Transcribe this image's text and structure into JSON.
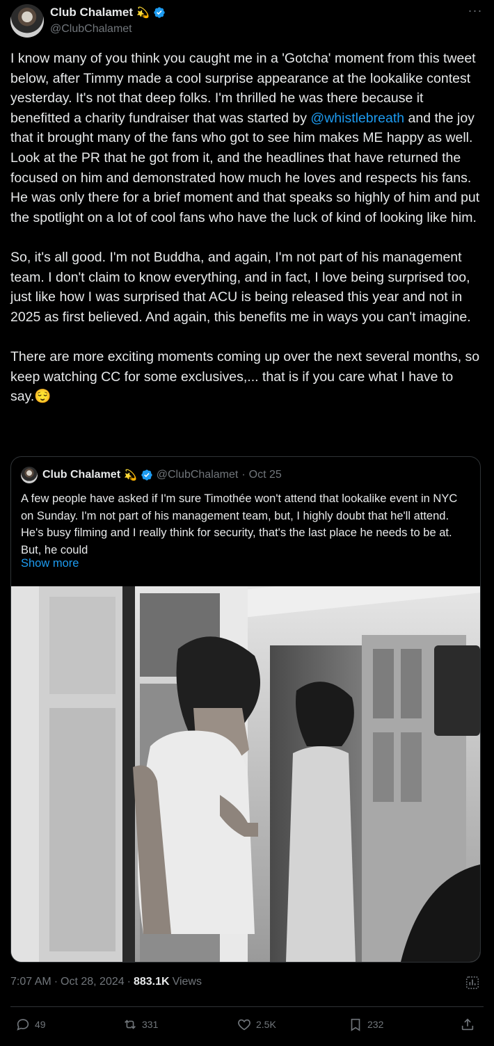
{
  "author": {
    "name": "Club Chalamet",
    "name_emoji": "💫",
    "handle": "@ClubChalamet"
  },
  "tweet": {
    "paragraphs": [
      {
        "before": "I know many of you think you caught me in a 'Gotcha' moment from this tweet below, after Timmy made a cool surprise appearance at the lookalike contest yesterday. It's not that deep folks. I'm thrilled he was there because it benefitted a charity fundraiser that was started by ",
        "mention": "@whistlebreath",
        "after": " and the joy that it brought many of the fans who got to see him makes ME happy as well. Look at the PR that he got from it, and the headlines that have returned the focused on him and demonstrated how much he loves and respects his fans. He was only there for a brief moment and that speaks so highly of him and put the spotlight on a lot of cool fans who have the luck of kind of looking like him."
      },
      {
        "text": "So, it's all good. I'm not Buddha, and again, I'm not part of his management team. I don't claim to know everything, and in fact, I love being surprised too, just like how I was surprised that ACU is being released this year and not in 2025 as first believed. And again, this benefits me in ways you can't imagine."
      },
      {
        "text": "There are more exciting moments coming up over the next several months, so keep watching CC for some exclusives,... that is if you care what I have to say.",
        "emoji": "😌"
      }
    ]
  },
  "quoted": {
    "name": "Club Chalamet",
    "name_emoji": "💫",
    "handle": "@ClubChalamet",
    "separator": "·",
    "date": "Oct 25",
    "text": "A few people have asked if I'm sure Timothée won't attend that lookalike event in NYC on Sunday. I'm not part of his management team, but, I highly doubt that he'll attend. He's busy filming and I really think for security, that's the last place he needs to be at. But, he could",
    "show_more": "Show more"
  },
  "meta": {
    "time": "7:07 AM",
    "sep1": "·",
    "date": "Oct 28, 2024",
    "sep2": "·",
    "views_count": "883.1K",
    "views_label": "Views"
  },
  "actions": {
    "replies": "49",
    "reposts": "331",
    "likes": "2.5K",
    "bookmarks": "232"
  },
  "colors": {
    "background": "#000000",
    "text": "#e7e9ea",
    "secondary": "#71767b",
    "accent": "#1d9bf0",
    "border": "#2f3336"
  },
  "icons": [
    "verified-badge-icon",
    "more-icon",
    "analytics-icon",
    "reply-icon",
    "repost-icon",
    "like-icon",
    "bookmark-icon",
    "share-icon"
  ]
}
